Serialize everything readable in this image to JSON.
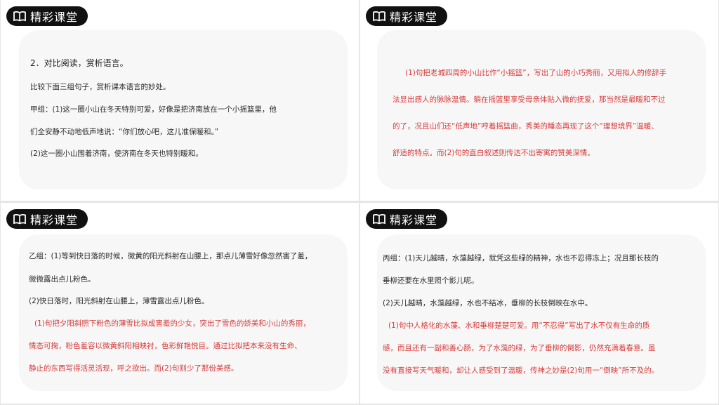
{
  "badge_label": "精彩课堂",
  "slide1": {
    "title": "2．对比阅读，赏析语言。",
    "intro": "比较下面三组句子，赏析课本语言的妙处。",
    "line1": "甲组：(1)这一圈小山在冬天特别可爱，好像是把济南放在一个小摇篮里，他",
    "line2": "们全安静不动地低声地说：“你们放心吧，这儿准保暖和。”",
    "line3": "(2)这一圈小山围着济南，使济南在冬天也特别暖和。"
  },
  "slide2": {
    "line1": "(1)句把老城四周的小山比作“小摇篮”，写出了山的小巧秀丽，又用拟人的修辞手",
    "line2": "法显出感人的脉脉温情。躺在摇篮里享受母亲体贴入微的抚爱，那当然是最暖和不过",
    "line3": "的了，况且山们还“低声地”哼着摇篮曲，秀美的睡态再现了这个“理想境界”温暖、",
    "line4": "舒适的特点。而(2)句的直白叙述则传达不出寄寓的赞美深情。"
  },
  "slide3": {
    "line1": "乙组：(1)等到快日落的时候，微黄的阳光斜射在山腰上，那点儿薄雪好像忽然害了羞，",
    "line2": "微微露出点儿粉色。",
    "line3": "(2)快日落时，阳光斜射在山腰上，薄雪露出点儿粉色。",
    "line4": "(1)句把夕阳斜照下粉色的薄雪比拟成害羞的少女，突出了雪色的娇美和小山的秀丽，",
    "line5": "情态可掬，粉色羞容以微黄斜阳相映衬，色彩鲜艳悦目。通过比拟把本来没有生命、",
    "line6": "静止的东西写得活灵活现，呼之欲出。而(2)句则少了那份美感。"
  },
  "slide4": {
    "line1": "丙组：(1)天儿越晴，水藻越绿，就凭这些绿的精神，水也不忍得冻上；况且那长枝的",
    "line2": "垂柳还要在水里照个影儿呢。",
    "line3": "(2)天儿越晴，水藻越绿，水也不结冰，垂柳的长枝倒映在水中。",
    "line4": "(1)句中人格化的水藻、水和垂柳楚楚可爱。用“不忍得”写出了水不仅有生命的质",
    "line5": "感，而且还有一副和善心肠，为了水藻的绿，为了垂柳的倒影，仍然充满着春意。虽",
    "line6": "没有直接写天气暖和，却让人感受到了温暖，传神之妙是(2)句用一“倒映”所不及的。"
  },
  "colors": {
    "badge_bg": "#111111",
    "answer_text": "#d93a3a",
    "body_text": "#2a2a2a"
  },
  "icons": {
    "badge": "open-book-icon"
  }
}
